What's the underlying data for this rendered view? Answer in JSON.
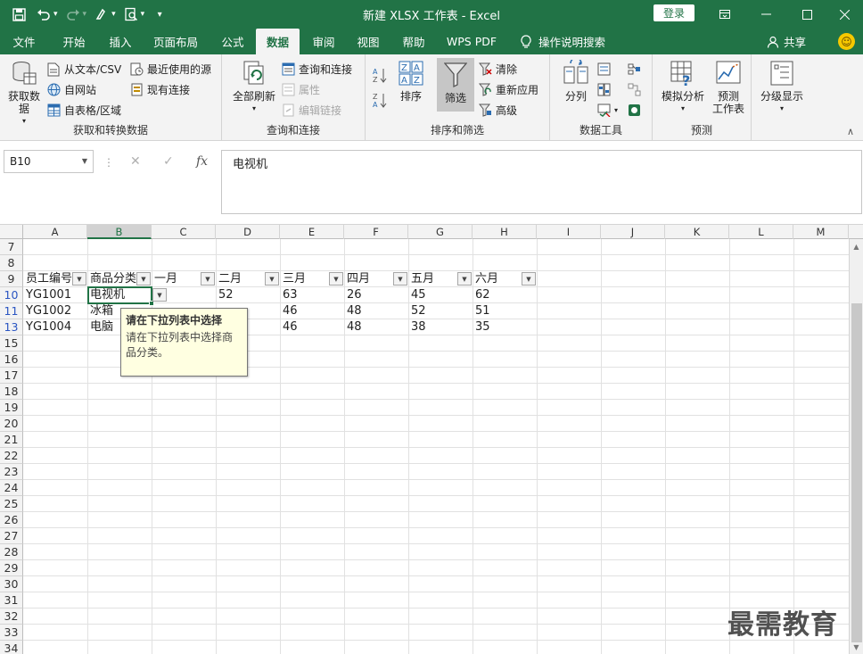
{
  "app": {
    "title": "新建 XLSX 工作表  -  Excel",
    "login_label": "登录",
    "share_label": "共享",
    "tell_me": "操作说明搜索"
  },
  "tabs": [
    {
      "label": "文件"
    },
    {
      "label": "开始"
    },
    {
      "label": "插入"
    },
    {
      "label": "页面布局"
    },
    {
      "label": "公式"
    },
    {
      "label": "数据",
      "active": true
    },
    {
      "label": "审阅"
    },
    {
      "label": "视图"
    },
    {
      "label": "帮助"
    },
    {
      "label": "WPS PDF"
    }
  ],
  "ribbon": {
    "get_transform": {
      "get_data": "获取数\n据",
      "from_text_csv": "从文本/CSV",
      "from_web": "自网站",
      "from_table": "自表格/区域",
      "recent_sources": "最近使用的源",
      "existing_connections": "现有连接",
      "label": "获取和转换数据"
    },
    "queries": {
      "refresh_all": "全部刷新",
      "queries_connections": "查询和连接",
      "properties": "属性",
      "edit_links": "编辑链接",
      "label": "查询和连接"
    },
    "sort_filter": {
      "sort": "排序",
      "filter": "筛选",
      "clear": "清除",
      "reapply": "重新应用",
      "advanced": "高级",
      "label": "排序和筛选"
    },
    "data_tools": {
      "text_to_columns": "分列",
      "label": "数据工具"
    },
    "forecast": {
      "what_if": "模拟分析",
      "forecast_sheet": "预测\n工作表",
      "label": "预测"
    },
    "outline": {
      "outline": "分级显示"
    }
  },
  "formula_bar": {
    "name_box": "B10",
    "formula": "电视机"
  },
  "sheet": {
    "columns": [
      "A",
      "B",
      "C",
      "D",
      "E",
      "F",
      "G",
      "H",
      "I",
      "J",
      "K",
      "L",
      "M"
    ],
    "selected_column": "B",
    "row_numbers": [
      "7",
      "8",
      "9",
      "10",
      "11",
      "13",
      "15",
      "16",
      "17",
      "18",
      "19",
      "20",
      "21",
      "22",
      "23",
      "24",
      "25",
      "26",
      "27",
      "28",
      "29",
      "30",
      "31",
      "32",
      "33",
      "34"
    ],
    "blue_rows": [
      "10",
      "11",
      "13"
    ],
    "header_row": [
      "员工编号",
      "商品分类",
      "一月",
      "二月",
      "三月",
      "四月",
      "五月",
      "六月"
    ],
    "rows": [
      [
        "YG1001",
        "电视机",
        "",
        "52",
        "63",
        "26",
        "45",
        "62"
      ],
      [
        "YG1002",
        "冰箱",
        "",
        "",
        "46",
        "48",
        "52",
        "51"
      ],
      [
        "YG1004",
        "电脑",
        "",
        "",
        "46",
        "48",
        "38",
        "35"
      ]
    ]
  },
  "tooltip": {
    "title": "请在下拉列表中选择",
    "body": "请在下拉列表中选择商品分类。"
  },
  "watermark": "最需教育",
  "colors": {
    "brand": "#217346",
    "ribbon_bg": "#f3f3f3",
    "tooltip_bg": "#ffffe1"
  }
}
